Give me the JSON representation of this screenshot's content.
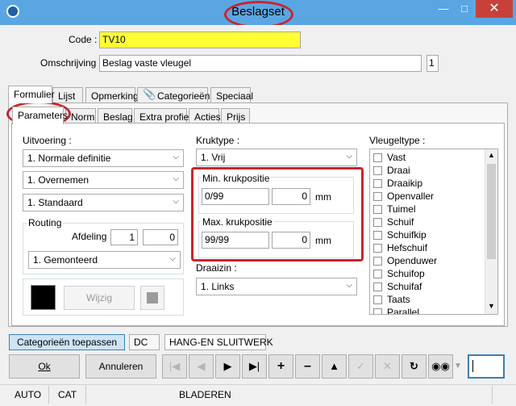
{
  "window": {
    "title": "Beslagset"
  },
  "form": {
    "code_label": "Code :",
    "code_value": "TV10",
    "description_label": "Omschrijving :",
    "description_value": "Beslag vaste vleugel",
    "description_count": "1"
  },
  "main_tabs": [
    "Formulier",
    "Lijst",
    "Opmerking",
    "Categorieën",
    "Speciaal"
  ],
  "sub_tabs": [
    "Parameters",
    "Norm",
    "Beslag",
    "Extra profiel",
    "Acties",
    "Prijs"
  ],
  "uitvoering": {
    "label": "Uitvoering :",
    "select1": "1.  Normale definitie",
    "select2": "1.  Overnemen",
    "select3": "1.  Standaard"
  },
  "routing": {
    "label": "Routing",
    "afdeling_label": "Afdeling :",
    "afdeling_value1": "1",
    "afdeling_value2": "0",
    "state": "1.  Gemonteerd"
  },
  "color_panel": {
    "wijzig_label": "Wijzig"
  },
  "kruktype": {
    "label": "Kruktype :",
    "value": "1.  Vrij",
    "min_label": "Min. krukpositie",
    "min_text": "0/99",
    "min_value": "0",
    "max_label": "Max. krukpositie",
    "max_text": "99/99",
    "max_value": "0",
    "unit": "mm"
  },
  "draaizin": {
    "label": "Draaizin :",
    "value": "1.  Links"
  },
  "vleugeltype": {
    "label": "Vleugeltype :",
    "items": [
      "Vast",
      "Draai",
      "Draaikip",
      "Openvaller",
      "Tuimel",
      "Schuif",
      "Schuifkip",
      "Hefschuif",
      "Openduwer",
      "Schuifop",
      "Schuifaf",
      "Taats",
      "Parallel"
    ]
  },
  "bottom_strip": {
    "apply_button": "Categorieën toepassen",
    "dc_label": "DC",
    "category_text": "HANG-EN SLUITWERK"
  },
  "toolbar": {
    "ok_label": "Ok",
    "cancel_label": "Annuleren"
  },
  "statusbar": {
    "mode": "AUTO",
    "cat": "CAT",
    "action": "BLADEREN"
  },
  "colors": {
    "title_bar": "#5aa6e3",
    "code_highlight": "#ffff33",
    "annotation_red": "#c9252c",
    "swatch_black": "#000000",
    "active_button": "#cce4f7"
  }
}
